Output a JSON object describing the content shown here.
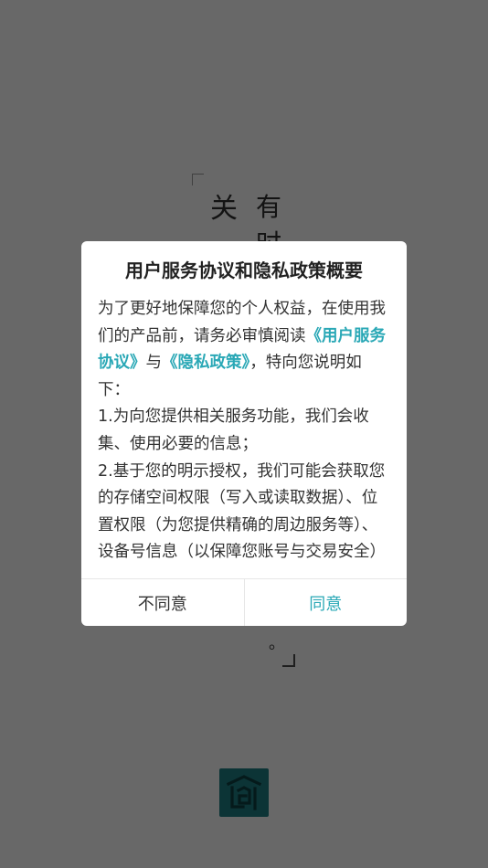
{
  "splash": {
    "char_1": "关",
    "char_2": "有",
    "char_3": "时",
    "dot": "。"
  },
  "dialog": {
    "title": "用户服务协议和隐私政策概要",
    "intro_prefix": "为了更好地保障您的个人权益，在使用我们的产品前，请务必审慎阅读",
    "user_agreement_link": "《用户服务协议》",
    "and_text": "与",
    "privacy_policy_link": "《隐私政策》",
    "intro_suffix": "，特向您说明如下：",
    "item_1": " 1.为向您提供相关服务功能，我们会收集、使用必要的信息；",
    "item_2": " 2.基于您的明示授权，我们可能会获取您的存储空间权限（写入或读取数据）、位置权限（为您提供精确的周边服务等）、设备号信息（以保障您账号与交易安全）",
    "disagree_label": "不同意",
    "agree_label": "同意"
  },
  "colors": {
    "accent": "#2aa8b6",
    "logo_bg": "#1d7d82",
    "overlay": "rgba(0,0,0,0.58)"
  },
  "icons": {
    "logo": "app-logo-icon"
  }
}
